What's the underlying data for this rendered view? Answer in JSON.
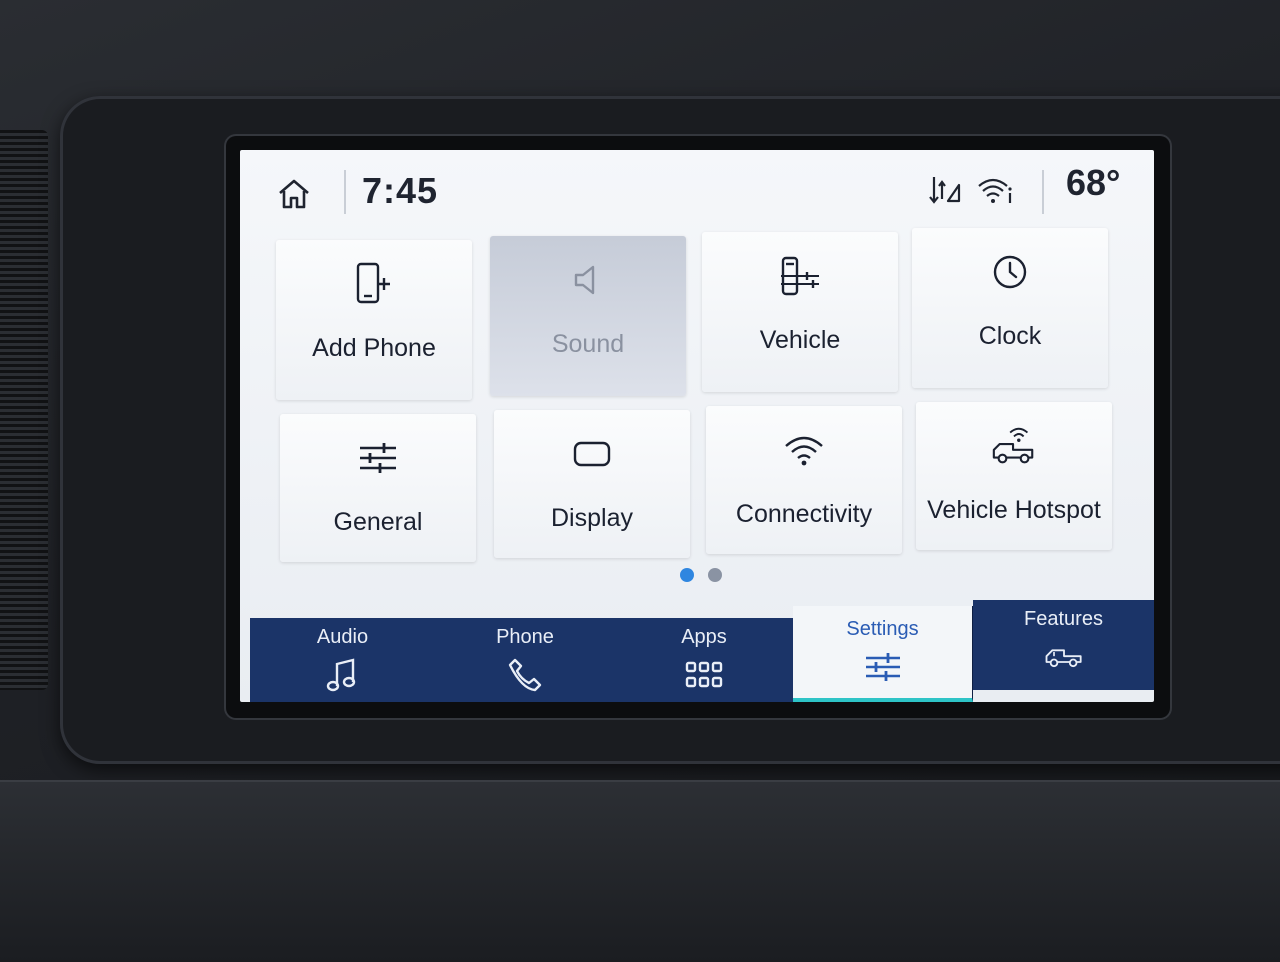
{
  "status_bar": {
    "time": "7:45",
    "temperature": "68°"
  },
  "tiles": [
    {
      "label": "Add Phone",
      "icon": "add-phone-icon",
      "enabled": true
    },
    {
      "label": "Sound",
      "icon": "speaker-icon",
      "enabled": false
    },
    {
      "label": "Vehicle",
      "icon": "vehicle-settings-icon",
      "enabled": true
    },
    {
      "label": "Clock",
      "icon": "clock-icon",
      "enabled": true
    },
    {
      "label": "General",
      "icon": "sliders-icon",
      "enabled": true
    },
    {
      "label": "Display",
      "icon": "display-icon",
      "enabled": true
    },
    {
      "label": "Connectivity",
      "icon": "wifi-icon",
      "enabled": true
    },
    {
      "label": "Vehicle Hotspot",
      "icon": "vehicle-hotspot-icon",
      "enabled": true
    }
  ],
  "pager": {
    "total": 2,
    "active_index": 0
  },
  "nav": {
    "items": [
      {
        "label": "Audio",
        "icon": "music-note-icon"
      },
      {
        "label": "Phone",
        "icon": "phone-icon"
      },
      {
        "label": "Apps",
        "icon": "apps-grid-icon"
      },
      {
        "label": "Settings",
        "icon": "settings-sliders-icon"
      },
      {
        "label": "Features",
        "icon": "truck-icon"
      }
    ],
    "active": "Settings"
  },
  "colors": {
    "nav_background": "#1b3468",
    "active_accent": "#2a5cb4",
    "active_underline": "#2ec4c7",
    "pager_active": "#2f86e0"
  }
}
